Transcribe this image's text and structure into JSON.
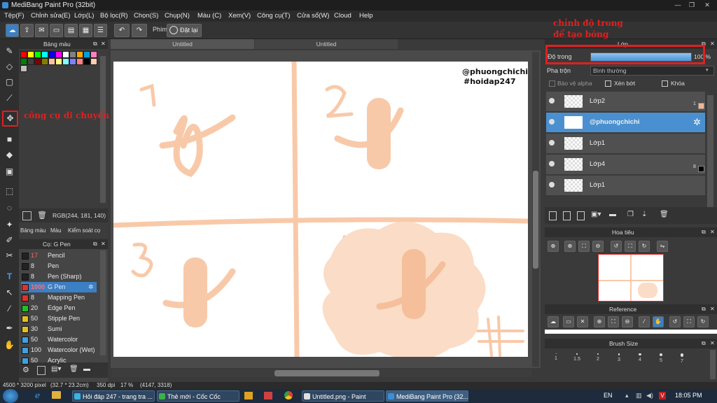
{
  "window": {
    "title": "MediBang Paint Pro (32bit)"
  },
  "menu": [
    "Tệp(F)",
    "Chỉnh sửa(E)",
    "Lớp(L)",
    "Bộ lọc(R)",
    "Chọn(S)",
    "Chụp(N)",
    "Màu (C)",
    "Xem(V)",
    "Công cụ(T)",
    "Cửa sổ(W)",
    "Cloud",
    "Help"
  ],
  "toolbar": {
    "key_label": "Phím",
    "reset_label": "Đặt lại"
  },
  "tabs": [
    "Untitled",
    "Untitled"
  ],
  "color_panel": {
    "title": "Bảng màu",
    "rgb": "RGB(244, 181, 140)",
    "tabs": [
      "Bảng màu",
      "Màu",
      "Kiểm soát cọ"
    ],
    "swatches": [
      "#ff0000",
      "#ffff00",
      "#00ff00",
      "#00ffff",
      "#0000ff",
      "#ff00ff",
      "#ffffff",
      "#808080",
      "#ffa500",
      "#00a0e0",
      "#ff80c0",
      "#008000",
      "#404040",
      "#800000",
      "#808000",
      "#ffc0a0",
      "#ffff80",
      "#80ffff",
      "#8080ff",
      "#ff8080",
      "#000000",
      "#ffd0b0",
      "#c0c0c0"
    ]
  },
  "brush_panel": {
    "title": "Cọ: G Pen",
    "brushes": [
      {
        "size": "17",
        "name": "Pencil",
        "color": "#222222"
      },
      {
        "size": "8",
        "name": "Pen",
        "color": "#222222"
      },
      {
        "size": "8",
        "name": "Pen (Sharp)",
        "color": "#222222"
      },
      {
        "size": "1000",
        "name": "G Pen",
        "color": "#e03030"
      },
      {
        "size": "8",
        "name": "Mapping Pen",
        "color": "#e03030"
      },
      {
        "size": "20",
        "name": "Edge Pen",
        "color": "#20c020"
      },
      {
        "size": "50",
        "name": "Stipple Pen",
        "color": "#e0c020"
      },
      {
        "size": "30",
        "name": "Sumi",
        "color": "#e0c020"
      },
      {
        "size": "50",
        "name": "Watercolor",
        "color": "#40a0e0"
      },
      {
        "size": "100",
        "name": "Watercolor (Wet)",
        "color": "#40a0e0"
      },
      {
        "size": "50",
        "name": "Acrylic",
        "color": "#40a0e0"
      }
    ]
  },
  "canvas": {
    "watermark_line1": "@phuongchichi",
    "watermark_line2": "#hoidap247",
    "numbers": [
      "1",
      "2",
      "3",
      "4"
    ],
    "stroke_color": "#f8c9a9",
    "cloud_color": "#fbdcc6"
  },
  "annotations": {
    "move_tool": "công cụ di chuyển",
    "opacity_line1": "chỉnh độ trong",
    "opacity_line2": "để tạo bóng"
  },
  "layer_panel": {
    "title": "Lớp",
    "opacity_label": "Độ trong",
    "opacity_value": "100 %",
    "opacity": 1.0,
    "blend_label": "Pha trộn",
    "blend_value": "Bình thường",
    "protect_alpha": "Bảo vệ alpha",
    "clipping": "Xén bớt",
    "lock": "Khóa",
    "layers": [
      {
        "name": "Lớp2",
        "badge": "1"
      },
      {
        "name": "@phuongchichi",
        "badge": ""
      },
      {
        "name": "Lớp1",
        "badge": ""
      },
      {
        "name": "Lớp4",
        "badge": "8"
      },
      {
        "name": "Lớp1",
        "badge": ""
      }
    ]
  },
  "navigator": {
    "title": "Hoa tiêu"
  },
  "reference": {
    "title": "Reference"
  },
  "brush_size": {
    "title": "Brush Size",
    "sizes": [
      "1",
      "1.5",
      "2",
      "3",
      "4",
      "5",
      "7"
    ]
  },
  "status": {
    "dims": "4500 * 3200 pixel",
    "cm": "(32.7 * 23.2cm)",
    "dpi": "350 dpi",
    "zoom": "17 %",
    "coords": "(4147, 3318)"
  },
  "taskbar": {
    "tasks": [
      "Hỏi đáp 247 - trang tra ...",
      "Thẻ mới - Cốc Cốc",
      "Untitled.png - Paint",
      "MediBang Paint Pro (32..."
    ],
    "lang": "EN",
    "time": "18:05 PM"
  }
}
